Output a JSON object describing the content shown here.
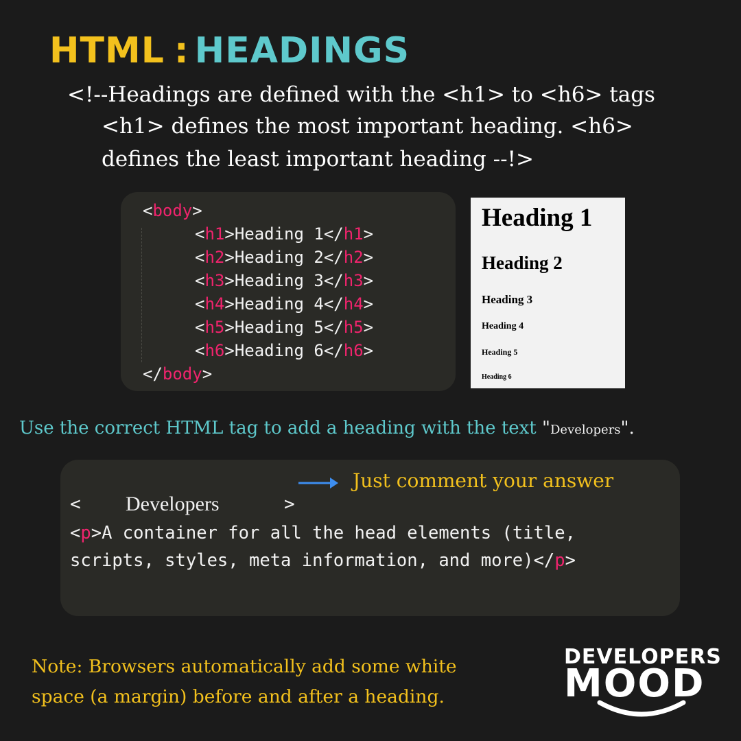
{
  "title": {
    "part1": "HTML",
    "separator": ":",
    "part2": "HEADINGS"
  },
  "intro": {
    "line1": "<!--Headings are defined with the <h1> to <h6> tags",
    "line2": "<h1> defines the most important heading. <h6>",
    "line3": "defines the least important heading --!>"
  },
  "code_example": {
    "open": {
      "lt": "<",
      "tag": "body",
      "gt": ">"
    },
    "lines": [
      {
        "tag": "h1",
        "text": "Heading 1"
      },
      {
        "tag": "h2",
        "text": "Heading 2"
      },
      {
        "tag": "h3",
        "text": "Heading 3"
      },
      {
        "tag": "h4",
        "text": "Heading 4"
      },
      {
        "tag": "h5",
        "text": "Heading 5"
      },
      {
        "tag": "h6",
        "text": "Heading 6"
      }
    ],
    "close": {
      "lt": "</",
      "tag": "body",
      "gt": ">"
    }
  },
  "preview": {
    "h1": "Heading 1",
    "h2": "Heading 2",
    "h3": "Heading 3",
    "h4": "Heading 4",
    "h5": "Heading 5",
    "h6": "Heading 6"
  },
  "task": {
    "text": "Use the correct HTML tag to add a heading with the text ",
    "answer": "Developers",
    "q_open": "\"",
    "q_close": "\"."
  },
  "exercise": {
    "hint": "Just comment your answer",
    "blank_open": "<",
    "blank_text": "Developers",
    "blank_close": ">",
    "p_tag": "p",
    "p_line1": "A container for all the head elements (title,",
    "p_line2": "scripts, styles, meta information, and more)"
  },
  "note": {
    "line1": "Note: Browsers automatically add some white",
    "line2": "space (a margin) before and after a heading."
  },
  "logo": {
    "word1": "DEVELOPERS",
    "word2": "MOOD"
  },
  "colors": {
    "background": "#1b1b1b",
    "yellow": "#f3c11d",
    "teal": "#5ec9cc",
    "tag_pink": "#f0246d",
    "code_bg": "#2a2a26",
    "arrow_blue": "#3d8ef0"
  }
}
